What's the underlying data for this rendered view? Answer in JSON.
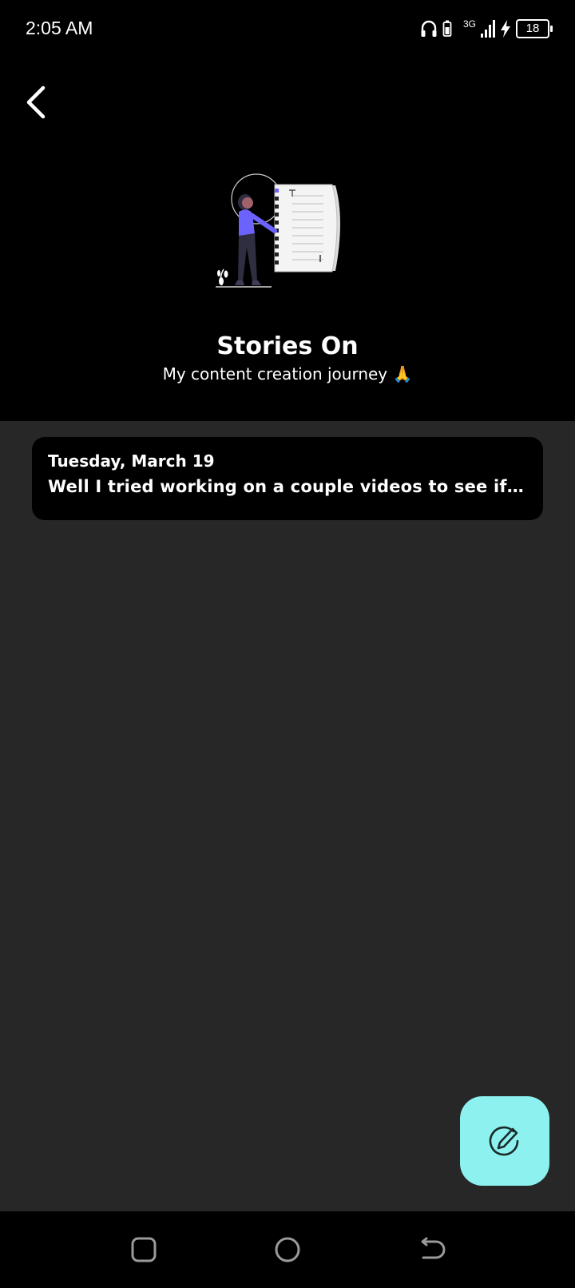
{
  "status_bar": {
    "time": "2:05 AM",
    "network": "3G",
    "battery": "18",
    "icons": [
      "headphones-icon",
      "battery-saver-icon",
      "signal-icon",
      "charging-icon",
      "battery-icon"
    ]
  },
  "header": {
    "back_icon": "back-arrow-icon",
    "title": "Stories On",
    "subtitle": "My content creation journey 🙏"
  },
  "stories": [
    {
      "date": "Tuesday, March 19",
      "text": "Well I tried working on a couple videos to see if I could"
    }
  ],
  "fab": {
    "icon": "compose-icon"
  },
  "nav_bar": {
    "icons": [
      "recents-square-icon",
      "home-circle-icon",
      "back-return-icon"
    ]
  },
  "colors": {
    "header_bg": "#000000",
    "body_bg": "#272727",
    "card_bg": "#000000",
    "fab_bg": "#8df2ef",
    "accent_purple": "#6c63ff"
  }
}
